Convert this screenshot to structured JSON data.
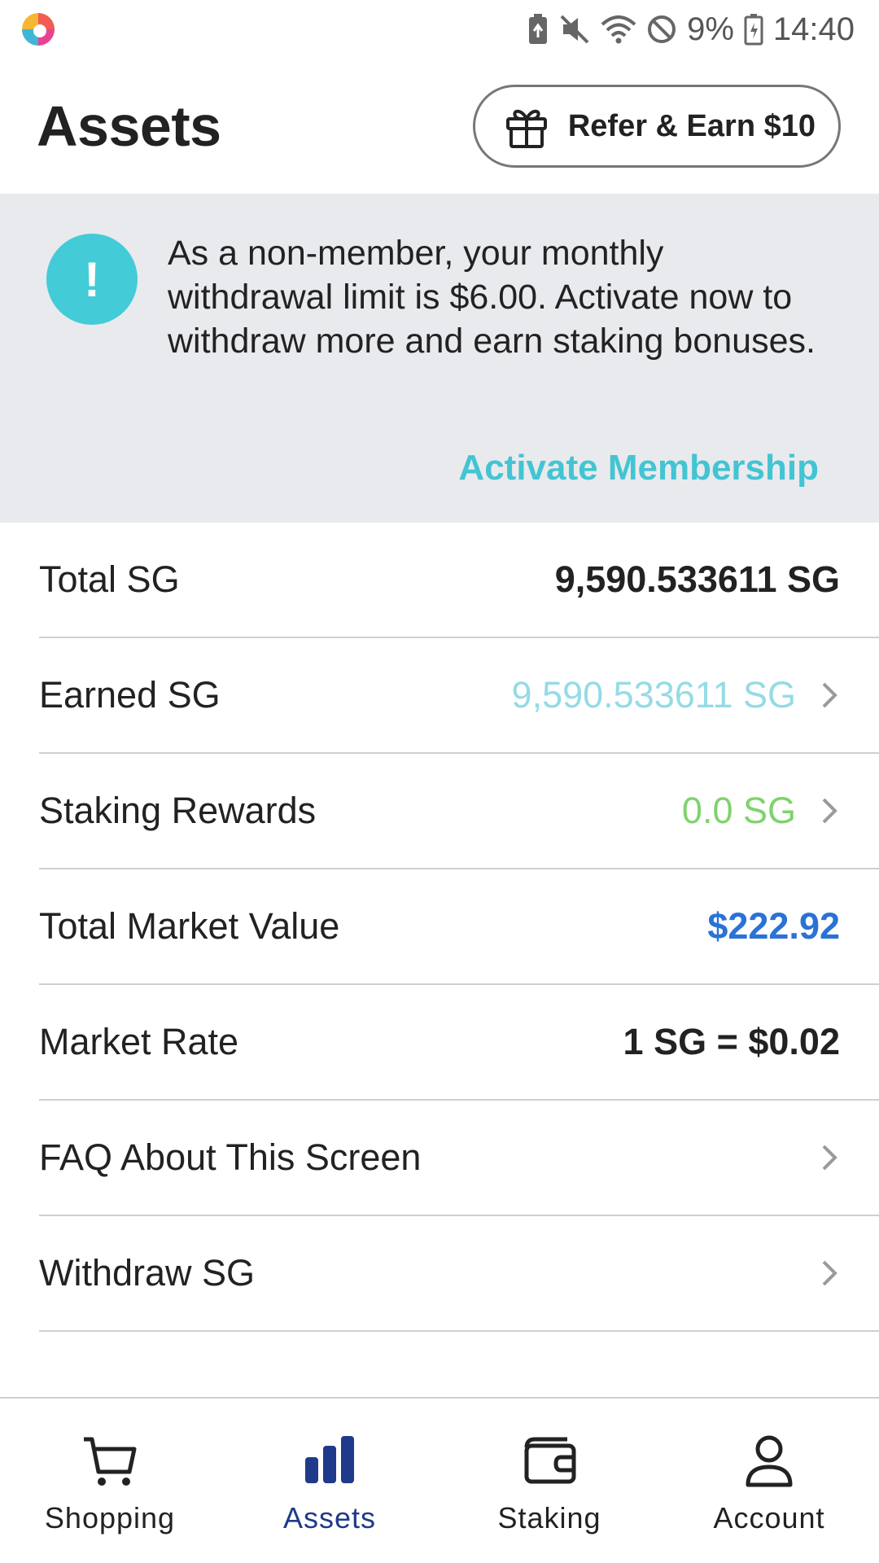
{
  "status_bar": {
    "app_icon": "colorful-circle-logo-icon",
    "icons": [
      "battery-saver-icon",
      "mute-icon",
      "wifi-icon",
      "do-not-disturb-icon",
      "battery-icon"
    ],
    "battery_percent": "9%",
    "time": "14:40"
  },
  "header": {
    "title": "Assets",
    "refer_button": {
      "icon": "gift-icon",
      "label": "Refer & Earn $10"
    }
  },
  "notice": {
    "icon": "exclamation-icon",
    "message": "As a non-member, your monthly withdrawal limit is $6.00. Activate now to withdraw more and earn staking bonuses.",
    "action_label": "Activate Membership",
    "accent_color": "#43cbd8"
  },
  "rows": [
    {
      "label": "Total SG",
      "value": "9,590.533611 SG"
    },
    {
      "label": "Earned SG",
      "value": "9,590.533611 SG"
    },
    {
      "label": "Staking Rewards",
      "value": "0.0 SG"
    },
    {
      "label": "Total Market Value",
      "value": "$222.92"
    },
    {
      "label": "Market Rate",
      "value": "1 SG = $0.02"
    },
    {
      "label": "FAQ About This Screen"
    },
    {
      "label": "Withdraw SG"
    }
  ],
  "colors": {
    "earned_value": "#94dbe6",
    "staking_value": "#7ed36b",
    "market_value": "#2a72d6",
    "active_nav": "#1f3a8a"
  },
  "bottom_nav": [
    {
      "label": "Shopping",
      "icon": "cart-icon"
    },
    {
      "label": "Assets",
      "icon": "bar-chart-icon",
      "active": true
    },
    {
      "label": "Staking",
      "icon": "wallet-icon"
    },
    {
      "label": "Account",
      "icon": "person-icon"
    }
  ]
}
